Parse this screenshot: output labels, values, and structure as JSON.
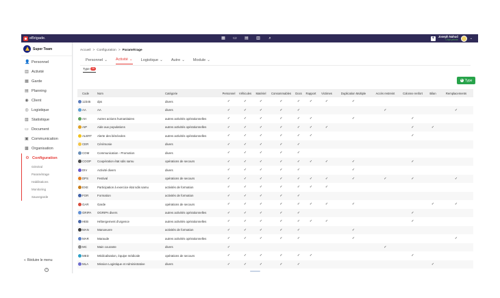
{
  "app": {
    "logo_text": "eBrigade."
  },
  "topbar": {
    "icons": [
      "calendar-icon",
      "document-icon",
      "calendar-check-icon",
      "clipboard-icon",
      "search-icon"
    ],
    "user_name": "Joseph Nahud",
    "user_role": "Chpt pêche"
  },
  "sidebar": {
    "team_name": "Super Team",
    "items": [
      {
        "label": "Personnel",
        "icon": "person-icon",
        "glyph": "👤"
      },
      {
        "label": "Activité",
        "icon": "activity-icon",
        "glyph": "▥"
      },
      {
        "label": "Garde",
        "icon": "guard-icon",
        "glyph": "▦"
      },
      {
        "label": "Planning",
        "icon": "planning-icon",
        "glyph": "▤"
      },
      {
        "label": "Client",
        "icon": "client-icon",
        "glyph": "◉"
      },
      {
        "label": "Logistique",
        "icon": "logistics-icon",
        "glyph": "◎"
      },
      {
        "label": "Statistique",
        "icon": "statistics-icon",
        "glyph": "▧"
      },
      {
        "label": "Document",
        "icon": "document-icon",
        "glyph": "▭"
      },
      {
        "label": "Communication",
        "icon": "communication-icon",
        "glyph": "▣"
      },
      {
        "label": "Organisation",
        "icon": "organisation-icon",
        "glyph": "▩"
      },
      {
        "label": "Configuration",
        "icon": "settings-icon",
        "glyph": "⚙"
      }
    ],
    "sub_items": [
      "Général",
      "Paramétrage",
      "Habilitations",
      "Monitoring",
      "Sauvegarde"
    ],
    "reduce_label": "Réduire le menu"
  },
  "breadcrumb": {
    "items": [
      "Accueil",
      "Configuration",
      "Paramétrage"
    ]
  },
  "tabs": [
    {
      "label": "Personnel"
    },
    {
      "label": "Activité"
    },
    {
      "label": "Logistique"
    },
    {
      "label": "Autre"
    },
    {
      "label": "Module"
    }
  ],
  "subtab": {
    "label": "Type",
    "count": "26"
  },
  "add_button": {
    "label": "Type"
  },
  "table": {
    "headers": [
      "Code",
      "Nom",
      "Catégorie",
      "Personnel",
      "Véhicules",
      "Matériel",
      "Consommables",
      "Docs",
      "Rapport",
      "Victimes",
      "Duplication Multiple",
      "Accès restreint",
      "Colonne renfort",
      "Bilan",
      "Remplacements"
    ],
    "rows": [
      {
        "code": "12345",
        "nom": "dps",
        "cat": "divers",
        "color": "#5c7cbc",
        "flags": [
          1,
          1,
          1,
          1,
          1,
          1,
          1,
          1,
          0,
          0,
          0,
          0
        ]
      },
      {
        "code": "AA",
        "nom": "AA",
        "cat": "divers",
        "color": "#5c9fd6",
        "flags": [
          1,
          1,
          1,
          1,
          1,
          0,
          0,
          0,
          1,
          0,
          0,
          1
        ]
      },
      {
        "code": "AH",
        "nom": "Autres actions humanitaires",
        "cat": "autres activités opérationnelles",
        "color": "#5da35d",
        "flags": [
          1,
          1,
          1,
          1,
          1,
          1,
          0,
          1,
          0,
          1,
          0,
          0
        ]
      },
      {
        "code": "AIP",
        "nom": "Aide aux populations",
        "cat": "autres activités opérationnelles",
        "color": "#e0a020",
        "flags": [
          1,
          1,
          1,
          1,
          1,
          1,
          1,
          0,
          0,
          1,
          1,
          0
        ]
      },
      {
        "code": "ALERT",
        "nom": "Alerte des bénévoles",
        "cat": "autres activités opérationnelles",
        "color": "#f2c21a",
        "flags": [
          1,
          1,
          1,
          1,
          1,
          1,
          0,
          0,
          0,
          1,
          0,
          0
        ]
      },
      {
        "code": "CER",
        "nom": "Cérémonie",
        "cat": "divers",
        "color": "#f4c542",
        "flags": [
          1,
          1,
          1,
          1,
          1,
          0,
          0,
          0,
          0,
          0,
          0,
          0
        ]
      },
      {
        "code": "COM",
        "nom": "Communication - Promotion",
        "cat": "divers",
        "color": "#6a8fb8",
        "flags": [
          1,
          1,
          1,
          1,
          1,
          0,
          0,
          0,
          0,
          0,
          0,
          0
        ]
      },
      {
        "code": "COOP",
        "nom": "Coopération état sdis samu",
        "cat": "opérations de secours",
        "color": "#4a4a4a",
        "flags": [
          1,
          1,
          1,
          1,
          1,
          1,
          1,
          1,
          0,
          1,
          0,
          0
        ]
      },
      {
        "code": "DIV",
        "nom": "Activité divers",
        "cat": "divers",
        "color": "#6a5acd",
        "flags": [
          1,
          1,
          1,
          1,
          1,
          0,
          0,
          1,
          0,
          0,
          0,
          0
        ]
      },
      {
        "code": "DPS",
        "nom": "Festival",
        "cat": "opérations de secours",
        "color": "#e57a17",
        "flags": [
          1,
          1,
          1,
          1,
          1,
          1,
          1,
          1,
          1,
          1,
          0,
          1
        ]
      },
      {
        "code": "EXE",
        "nom": "Participation à exercice état sdis samu",
        "cat": "activités de formation",
        "color": "#c77b16",
        "flags": [
          1,
          1,
          1,
          1,
          1,
          1,
          1,
          0,
          0,
          0,
          0,
          0
        ]
      },
      {
        "code": "FOR",
        "nom": "Formation",
        "cat": "activités de formation",
        "color": "#3d5fa8",
        "flags": [
          1,
          1,
          1,
          1,
          1,
          0,
          0,
          0,
          0,
          0,
          0,
          0
        ]
      },
      {
        "code": "GAR",
        "nom": "Garde",
        "cat": "opérations de secours",
        "color": "#d84a3a",
        "flags": [
          1,
          1,
          1,
          1,
          1,
          1,
          1,
          1,
          0,
          0,
          1,
          1
        ]
      },
      {
        "code": "GRIPA",
        "nom": "OGRIPA divers",
        "cat": "autres activités opérationnelles",
        "color": "#5f8fd6",
        "flags": [
          1,
          1,
          1,
          1,
          1,
          0,
          0,
          0,
          0,
          1,
          0,
          0
        ]
      },
      {
        "code": "HEB",
        "nom": "Hébergement d'urgence",
        "cat": "autres activités opérationnelles",
        "color": "#4a67a8",
        "flags": [
          1,
          1,
          1,
          1,
          1,
          1,
          1,
          0,
          0,
          1,
          0,
          0
        ]
      },
      {
        "code": "MAN",
        "nom": "Manoeuvre",
        "cat": "activités de formation",
        "color": "#3a3a3a",
        "flags": [
          1,
          1,
          1,
          1,
          1,
          0,
          0,
          1,
          0,
          0,
          0,
          0
        ]
      },
      {
        "code": "MAR",
        "nom": "Maraude",
        "cat": "autres activités opérationnelles",
        "color": "#5b7fc4",
        "flags": [
          1,
          1,
          1,
          1,
          1,
          0,
          0,
          1,
          0,
          0,
          0,
          1
        ]
      },
      {
        "code": "MC",
        "nom": "Main courante",
        "cat": "divers",
        "color": "#8a8a8a",
        "flags": [
          1,
          0,
          0,
          0,
          0,
          0,
          0,
          0,
          1,
          0,
          0,
          0
        ]
      },
      {
        "code": "MED",
        "nom": "Médicalisation, équipe médicale",
        "cat": "opérations de secours",
        "color": "#2aa0c8",
        "flags": [
          1,
          1,
          1,
          1,
          1,
          1,
          0,
          0,
          0,
          1,
          0,
          0
        ]
      },
      {
        "code": "MLA",
        "nom": "Mission Logistique et Administrative",
        "cat": "divers",
        "color": "#6c6cd0",
        "flags": [
          1,
          1,
          1,
          1,
          1,
          0,
          0,
          0,
          0,
          0,
          1,
          0
        ]
      }
    ]
  }
}
